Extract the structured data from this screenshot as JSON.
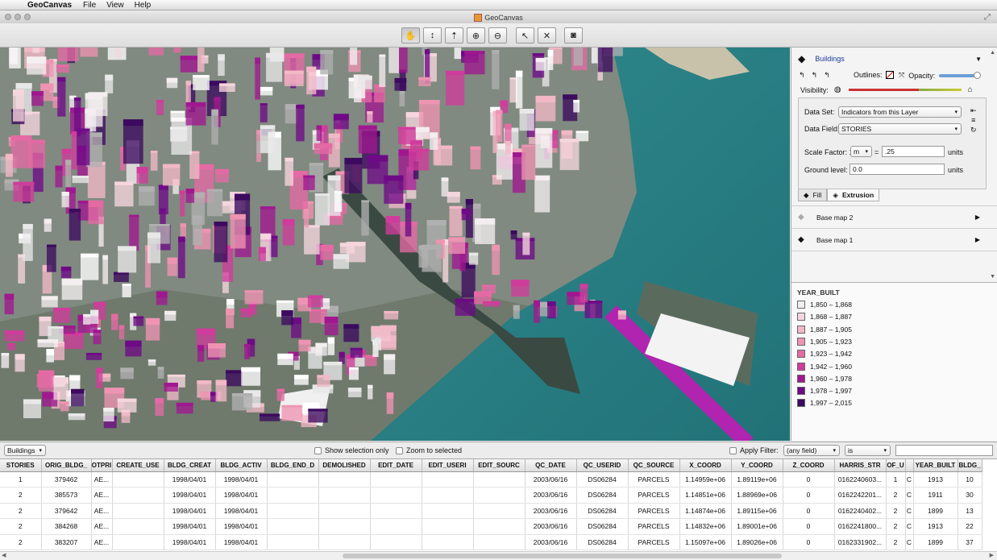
{
  "menubar": {
    "app": "GeoCanvas",
    "items": [
      "File",
      "View",
      "Help"
    ]
  },
  "window": {
    "title": "GeoCanvas"
  },
  "toolbar": {
    "tools": [
      {
        "name": "pan-tool-icon",
        "glyph": "✋"
      },
      {
        "name": "tilt-tool-icon",
        "glyph": "↕"
      },
      {
        "name": "rotate-tool-icon",
        "glyph": "⇡"
      },
      {
        "name": "zoom-in-icon",
        "glyph": "⊕"
      },
      {
        "name": "zoom-out-icon",
        "glyph": "⊖"
      },
      {
        "name": "select-tool-icon",
        "glyph": "↖"
      },
      {
        "name": "clear-selection-icon",
        "glyph": "✕"
      },
      {
        "name": "camera-icon",
        "glyph": "◙"
      }
    ]
  },
  "layer_panel": {
    "layer_name": "Buildings",
    "outlines_label": "Outlines:",
    "opacity_label": "Opacity:",
    "visibility_label": "Visibility:",
    "data_set_label": "Data Set:",
    "data_set_value": "Indicators from this Layer",
    "data_field_label": "Data Field:",
    "data_field_value": "STORIES",
    "scale_factor_label": "Scale Factor: 1",
    "scale_unit": "m",
    "equals": "=",
    "scale_value": ".25",
    "units_label": "units",
    "ground_label": "Ground level:",
    "ground_value": "0.0",
    "tabs": [
      "Fill",
      "Extrusion"
    ],
    "basemaps": [
      "Base map 2",
      "Base map 1"
    ]
  },
  "legend": {
    "title": "YEAR_BUILT",
    "items": [
      {
        "label": "1,850 – 1,868",
        "color": "#f4eef0"
      },
      {
        "label": "1,868 – 1,887",
        "color": "#f6d6de"
      },
      {
        "label": "1,887 – 1,905",
        "color": "#f2b8c6"
      },
      {
        "label": "1,905 – 1,923",
        "color": "#ee94b2"
      },
      {
        "label": "1,923 – 1,942",
        "color": "#e46aa4"
      },
      {
        "label": "1,942 – 1,960",
        "color": "#d03c9c"
      },
      {
        "label": "1,960 – 1,978",
        "color": "#a01890"
      },
      {
        "label": "1,978 – 1,997",
        "color": "#6e0a86"
      },
      {
        "label": "1,997 – 2,015",
        "color": "#3c0a5e"
      }
    ]
  },
  "filterbar": {
    "layer_select": "Buildings",
    "show_selection": "Show selection only",
    "zoom_selected": "Zoom to selected",
    "apply_filter": "Apply Filter:",
    "field_select": "(any field)",
    "op_select": "is",
    "value": ""
  },
  "table": {
    "columns": [
      "STORIES",
      "ORIG_BLDG_",
      "OTPRI",
      "CREATE_USE",
      "BLDG_CREAT",
      "BLDG_ACTIV",
      "BLDG_END_D",
      "DEMOLISHED",
      "EDIT_DATE",
      "EDIT_USERI",
      "EDIT_SOURC",
      "QC_DATE",
      "QC_USERID",
      "QC_SOURCE",
      "X_COORD",
      "Y_COORD",
      "Z_COORD",
      "HARRIS_STR",
      "OF_U",
      "",
      "YEAR_BUILT",
      "BLDG_"
    ],
    "rows": [
      [
        "1",
        "379462",
        "AE...",
        "",
        "1998/04/01",
        "1998/04/01",
        "",
        "",
        "",
        "",
        "",
        "2003/06/16",
        "DS06284",
        "PARCELS",
        "1.14959e+06",
        "1.89119e+06",
        "0",
        "0162240603...",
        "1",
        "C",
        "1913",
        "10"
      ],
      [
        "2",
        "385573",
        "AE...",
        "",
        "1998/04/01",
        "1998/04/01",
        "",
        "",
        "",
        "",
        "",
        "2003/06/16",
        "DS06284",
        "PARCELS",
        "1.14851e+06",
        "1.88969e+06",
        "0",
        "0162242201...",
        "2",
        "C",
        "1911",
        "30"
      ],
      [
        "2",
        "379642",
        "AE...",
        "",
        "1998/04/01",
        "1998/04/01",
        "",
        "",
        "",
        "",
        "",
        "2003/06/16",
        "DS06284",
        "PARCELS",
        "1.14874e+06",
        "1.89115e+06",
        "0",
        "0162240402...",
        "2",
        "C",
        "1899",
        "13"
      ],
      [
        "2",
        "384268",
        "AE...",
        "",
        "1998/04/01",
        "1998/04/01",
        "",
        "",
        "",
        "",
        "",
        "2003/06/16",
        "DS06284",
        "PARCELS",
        "1.14832e+06",
        "1.89001e+06",
        "0",
        "0162241800...",
        "2",
        "C",
        "1913",
        "22"
      ],
      [
        "2",
        "383207",
        "AE...",
        "",
        "1998/04/01",
        "1998/04/01",
        "",
        "",
        "",
        "",
        "",
        "2003/06/16",
        "DS06284",
        "PARCELS",
        "1.15097e+06",
        "1.89026e+06",
        "0",
        "0162331902...",
        "2",
        "C",
        "1899",
        "37"
      ]
    ]
  }
}
